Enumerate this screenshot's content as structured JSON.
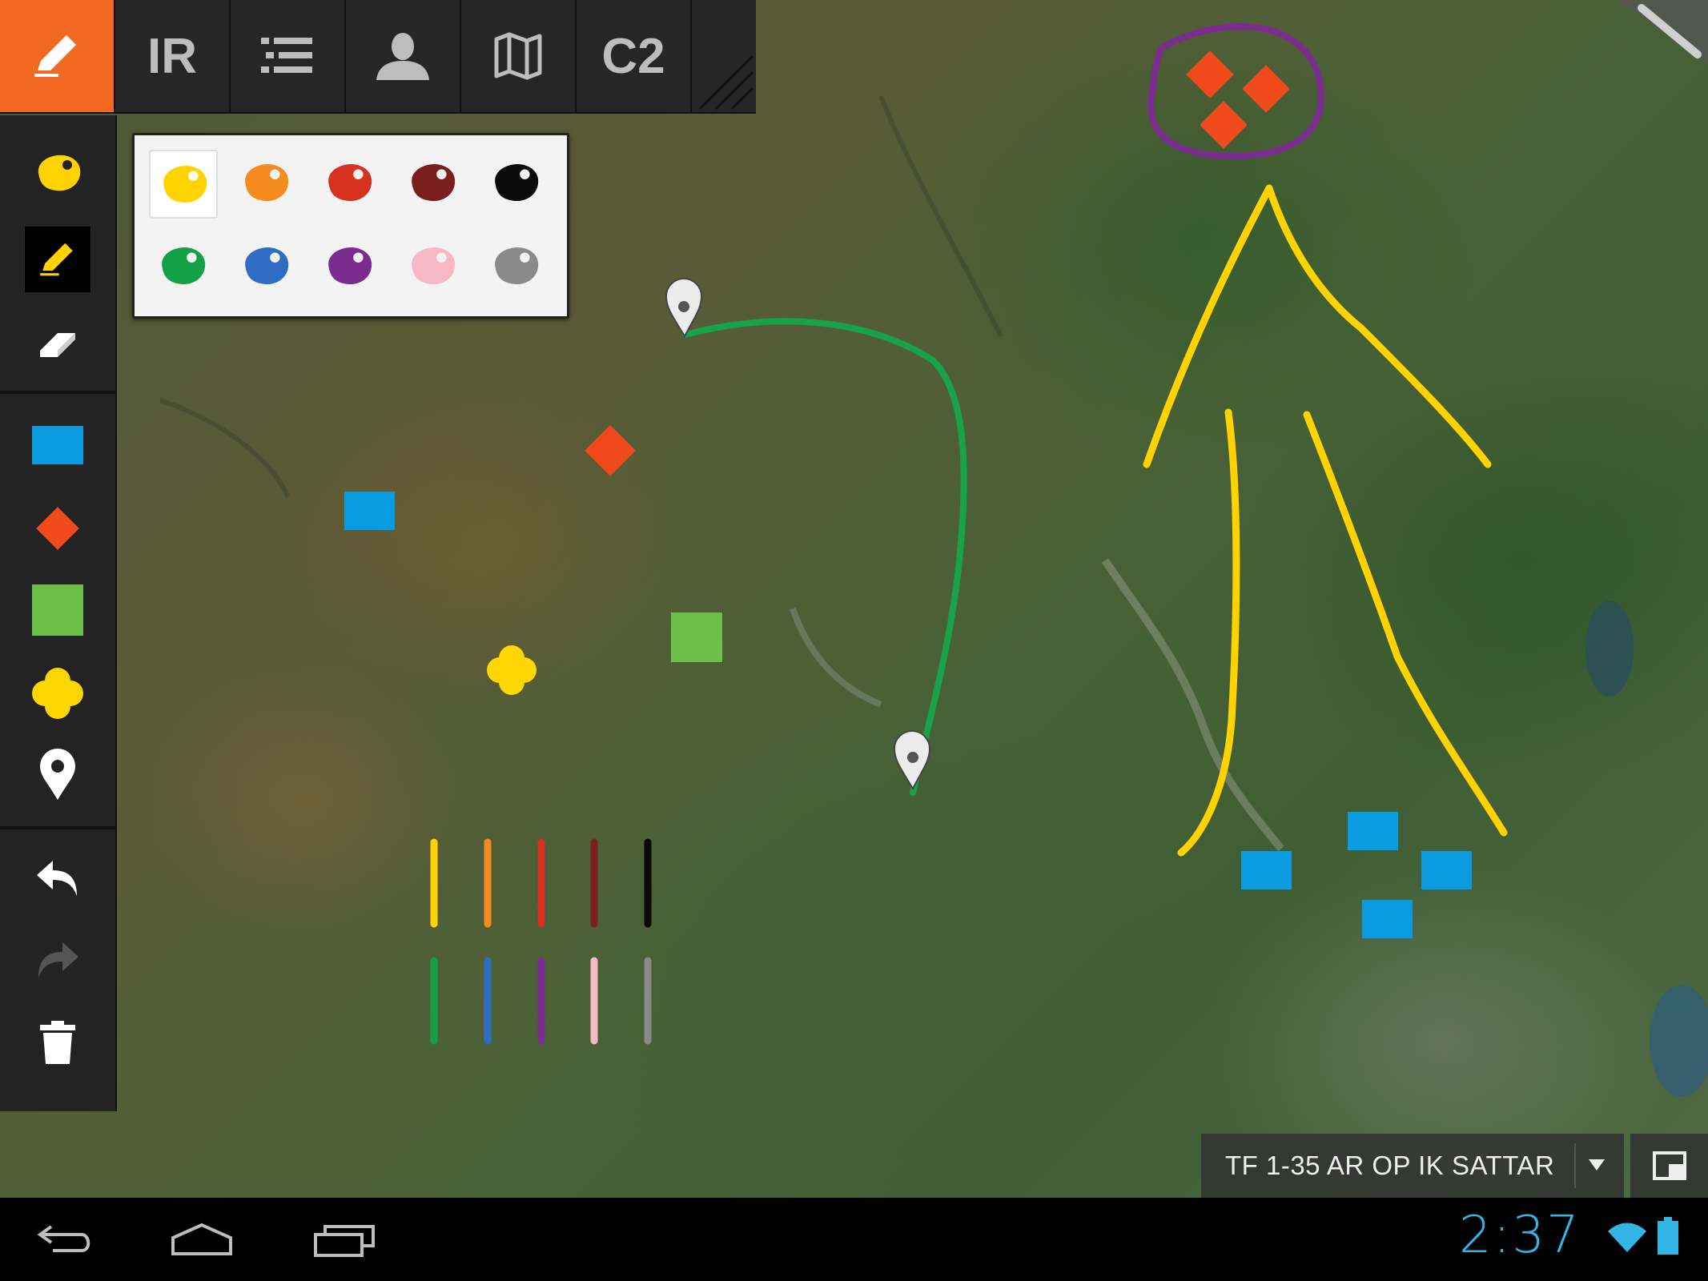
{
  "tabs": [
    {
      "label": "",
      "icon": "pencil-icon",
      "active": true
    },
    {
      "label": "IR",
      "icon": "",
      "active": false
    },
    {
      "label": "",
      "icon": "list-icon",
      "active": false
    },
    {
      "label": "",
      "icon": "person-icon",
      "active": false
    },
    {
      "label": "",
      "icon": "map-icon",
      "active": false
    },
    {
      "label": "C2",
      "icon": "",
      "active": false
    }
  ],
  "toolbar": {
    "tools": [
      "palette-icon",
      "pencil-icon",
      "eraser-icon",
      "blue-rectangle-icon",
      "red-diamond-icon",
      "green-square-icon",
      "yellow-cluster-icon",
      "map-pin-icon",
      "undo-icon",
      "redo-icon",
      "trash-icon"
    ],
    "selected": "pencil-icon"
  },
  "palette": {
    "colors": [
      "#ffd200",
      "#f58a1f",
      "#d7311f",
      "#7a1e1e",
      "#0a0a0a",
      "#13a047",
      "#2f6dc4",
      "#7a2d8e",
      "#f7b8c6",
      "#8a8a8a"
    ],
    "selected": "#ffd200"
  },
  "map": {
    "colors": {
      "blue_unit": "#0a9be0",
      "red_unit": "#f04a1c",
      "green_unit": "#6cc04a",
      "yellow_unit": "#ffd600",
      "route": "#16a34a",
      "arrows": "#ffd200",
      "circle": "#7a2d8e"
    }
  },
  "unit_selector": {
    "label": "TF 1-35 AR OP IK SATTAR"
  },
  "system": {
    "time": "2:37",
    "accent": "#33b5e5"
  }
}
